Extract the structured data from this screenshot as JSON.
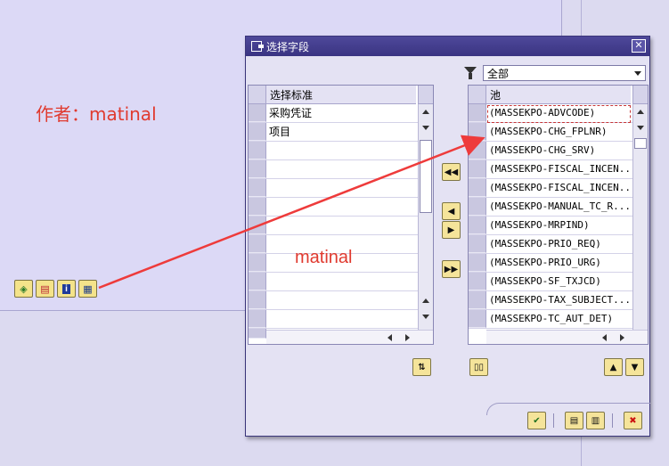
{
  "background": {
    "author_note": "作者：matinal",
    "toolbar_icons": [
      "layout-icon",
      "save-layout-icon",
      "info-icon",
      "change-layout-icon"
    ]
  },
  "dialog": {
    "title": "选择字段",
    "close_icon": "close-icon",
    "filter": {
      "icon": "filter-icon",
      "selected": "全部"
    },
    "left_table": {
      "header": "选择标准",
      "rows": [
        "采购凭证",
        "项目",
        "",
        "",
        "",
        "",
        "",
        "",
        "",
        "",
        "",
        "",
        ""
      ]
    },
    "right_table": {
      "header": "池",
      "rows": [
        "(MASSEKPO-ADVCODE)",
        "(MASSEKPO-CHG_FPLNR)",
        "(MASSEKPO-CHG_SRV)",
        "(MASSEKPO-FISCAL_INCEN...",
        "(MASSEKPO-FISCAL_INCEN...",
        "(MASSEKPO-MANUAL_TC_R...",
        "(MASSEKPO-MRPIND)",
        "(MASSEKPO-PRIO_REQ)",
        "(MASSEKPO-PRIO_URG)",
        "(MASSEKPO-SF_TXJCD)",
        "(MASSEKPO-TAX_SUBJECT...",
        "(MASSEKPO-TC_AUT_DET)"
      ]
    },
    "move_buttons": [
      "move-all-left-icon",
      "move-left-icon",
      "move-right-icon",
      "move-all-right-icon"
    ],
    "footer_buttons": [
      "confirm-icon",
      "copy-icon",
      "copy-as-icon",
      "cancel-icon"
    ]
  },
  "annotation_text": "matinal",
  "colors": {
    "annotation": "#e03a2f",
    "titlebar": "#3f3987",
    "button_yellow": "#f5e49a"
  }
}
